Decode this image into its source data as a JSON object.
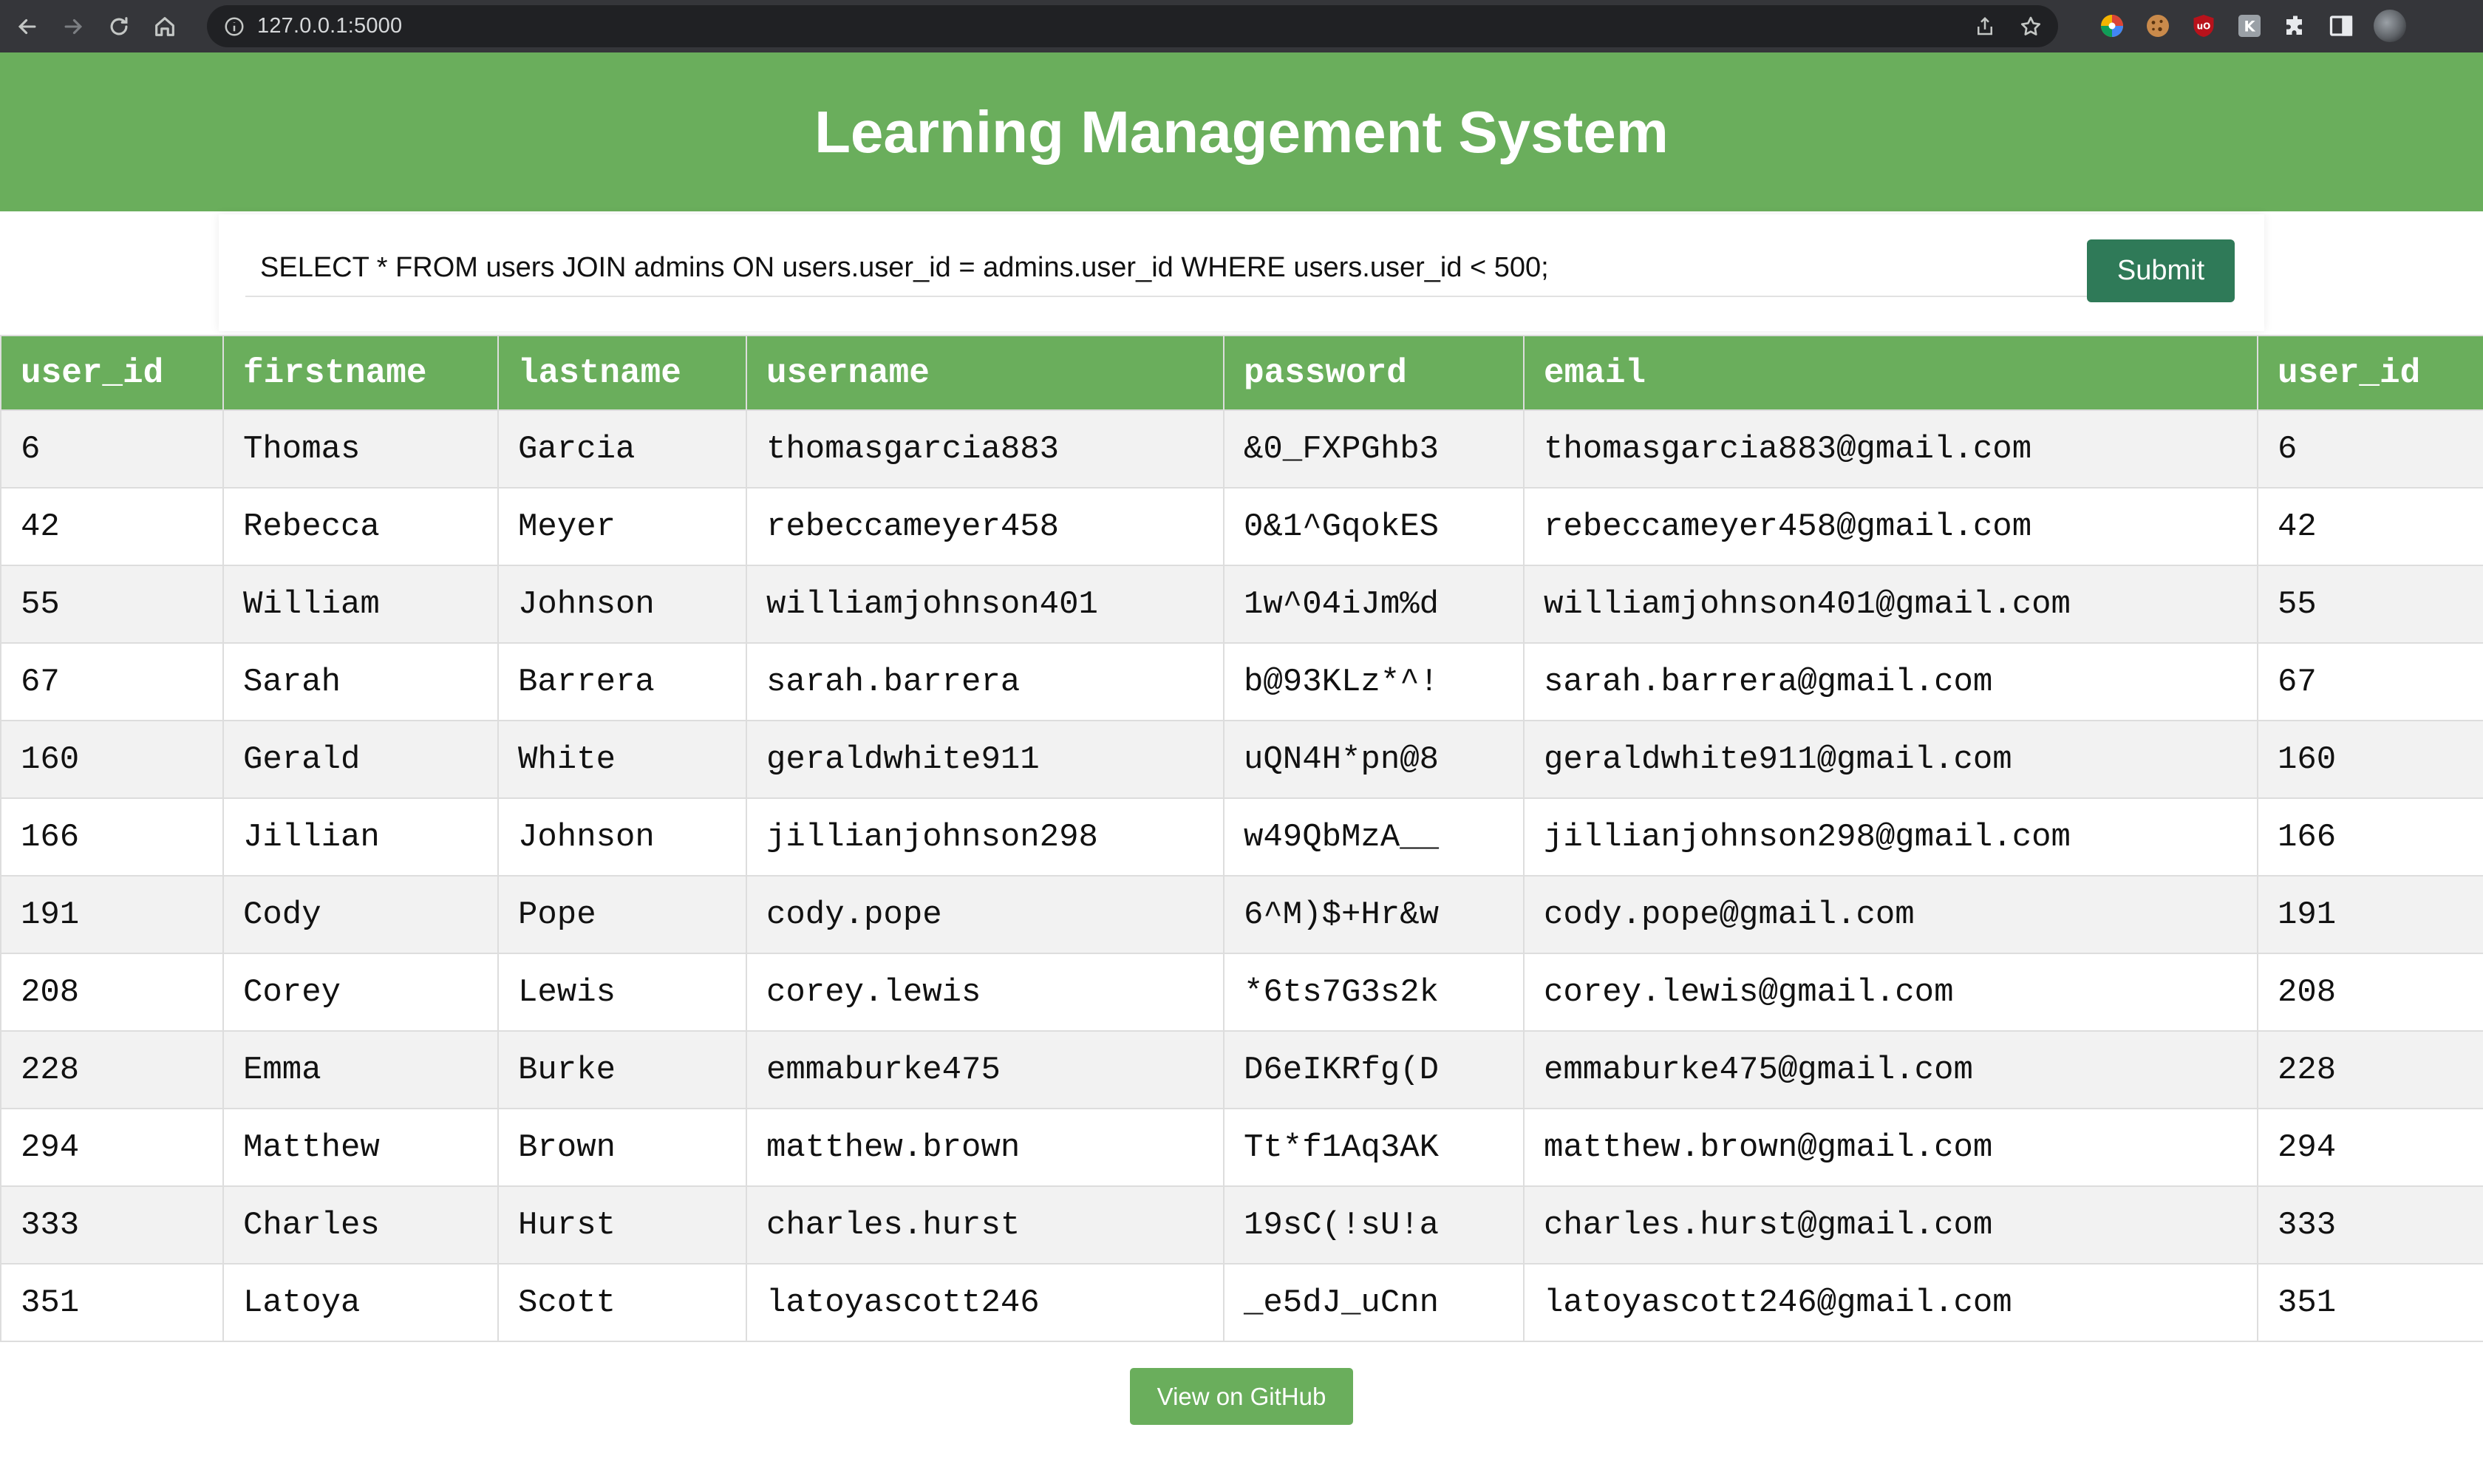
{
  "browser": {
    "url": "127.0.0.1:5000",
    "nav_icons": [
      "back-icon",
      "forward-icon",
      "reload-icon",
      "home-icon"
    ],
    "omnibox_icons": [
      "site-info-icon",
      "share-icon",
      "bookmark-star-icon"
    ],
    "extension_icons": [
      "color-wheel-icon",
      "cookie-icon",
      "ublock-icon",
      "k-extension-icon",
      "puzzle-icon",
      "sidebar-icon"
    ],
    "profile_icon": "avatar"
  },
  "app": {
    "title": "Learning Management System"
  },
  "query": {
    "value": "SELECT * FROM users JOIN admins ON users.user_id = admins.user_id WHERE users.user_id < 500;",
    "submit_label": "Submit"
  },
  "table": {
    "headers": [
      "user_id",
      "firstname",
      "lastname",
      "username",
      "password",
      "email",
      "user_id"
    ],
    "rows": [
      [
        "6",
        "Thomas",
        "Garcia",
        "thomasgarcia883",
        "&0_FXPGhb3",
        "thomasgarcia883@gmail.com",
        "6"
      ],
      [
        "42",
        "Rebecca",
        "Meyer",
        "rebeccameyer458",
        "0&1^GqokES",
        "rebeccameyer458@gmail.com",
        "42"
      ],
      [
        "55",
        "William",
        "Johnson",
        "williamjohnson401",
        "1w^04iJm%d",
        "williamjohnson401@gmail.com",
        "55"
      ],
      [
        "67",
        "Sarah",
        "Barrera",
        "sarah.barrera",
        "b@93KLz*^!",
        "sarah.barrera@gmail.com",
        "67"
      ],
      [
        "160",
        "Gerald",
        "White",
        "geraldwhite911",
        "uQN4H*pn@8",
        "geraldwhite911@gmail.com",
        "160"
      ],
      [
        "166",
        "Jillian",
        "Johnson",
        "jillianjohnson298",
        "w49QbMzA__",
        "jillianjohnson298@gmail.com",
        "166"
      ],
      [
        "191",
        "Cody",
        "Pope",
        "cody.pope",
        "6^M)$+Hr&w",
        "cody.pope@gmail.com",
        "191"
      ],
      [
        "208",
        "Corey",
        "Lewis",
        "corey.lewis",
        "*6ts7G3s2k",
        "corey.lewis@gmail.com",
        "208"
      ],
      [
        "228",
        "Emma",
        "Burke",
        "emmaburke475",
        "D6eIKRfg(D",
        "emmaburke475@gmail.com",
        "228"
      ],
      [
        "294",
        "Matthew",
        "Brown",
        "matthew.brown",
        "Tt*f1Aq3AK",
        "matthew.brown@gmail.com",
        "294"
      ],
      [
        "333",
        "Charles",
        "Hurst",
        "charles.hurst",
        "19sC(!sU!a",
        "charles.hurst@gmail.com",
        "333"
      ],
      [
        "351",
        "Latoya",
        "Scott",
        "latoyascott246",
        "_e5dJ_uCnn",
        "latoyascott246@gmail.com",
        "351"
      ]
    ]
  },
  "footer": {
    "github_label": "View on GitHub"
  },
  "colors": {
    "header_green": "#6aae5c",
    "submit_green": "#2f7a58",
    "row_alt": "#f2f2f2"
  }
}
